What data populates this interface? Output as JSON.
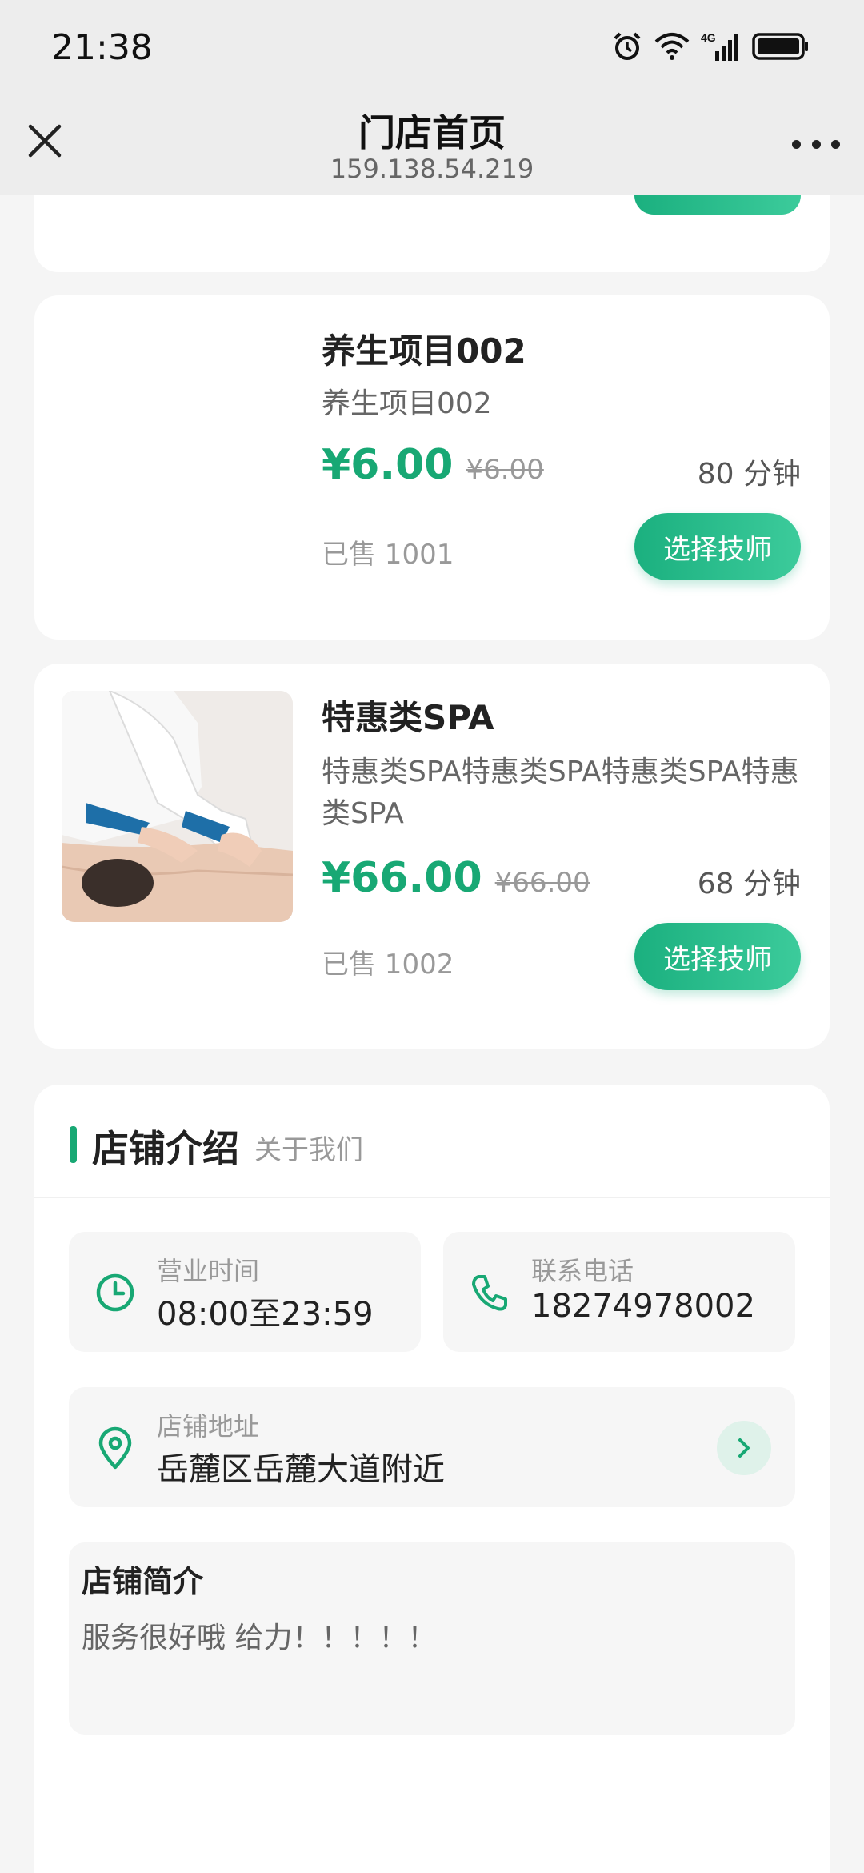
{
  "status_bar": {
    "time": "21:38",
    "network": "4G"
  },
  "title_bar": {
    "title": "门店首页",
    "subtitle": "159.138.54.219"
  },
  "services": [
    {
      "name": "养生项目002",
      "desc": "养生项目002",
      "price": "¥6.00",
      "orig_price": "¥6.00",
      "duration": "80 分钟",
      "sold": "已售 1001",
      "button": "选择技师",
      "has_image": false
    },
    {
      "name": "特惠类SPA",
      "desc": "特惠类SPA特惠类SPA特惠类SPA特惠类SPA",
      "price": "¥66.00",
      "orig_price": "¥66.00",
      "duration": "68 分钟",
      "sold": "已售 1002",
      "button": "选择技师",
      "has_image": true
    }
  ],
  "store": {
    "section_title": "店铺介绍",
    "section_sub": "关于我们",
    "hours_label": "营业时间",
    "hours_value": "08:00至23:59",
    "phone_label": "联系电话",
    "phone_value": "18274978002",
    "address_label": "店铺地址",
    "address_value": "岳麓区岳麓大道附近",
    "intro_title": "店铺简介",
    "intro_text": "服务很好哦  给力！！！！！"
  },
  "colors": {
    "accent": "#18a874",
    "background": "#f5f5f5"
  }
}
